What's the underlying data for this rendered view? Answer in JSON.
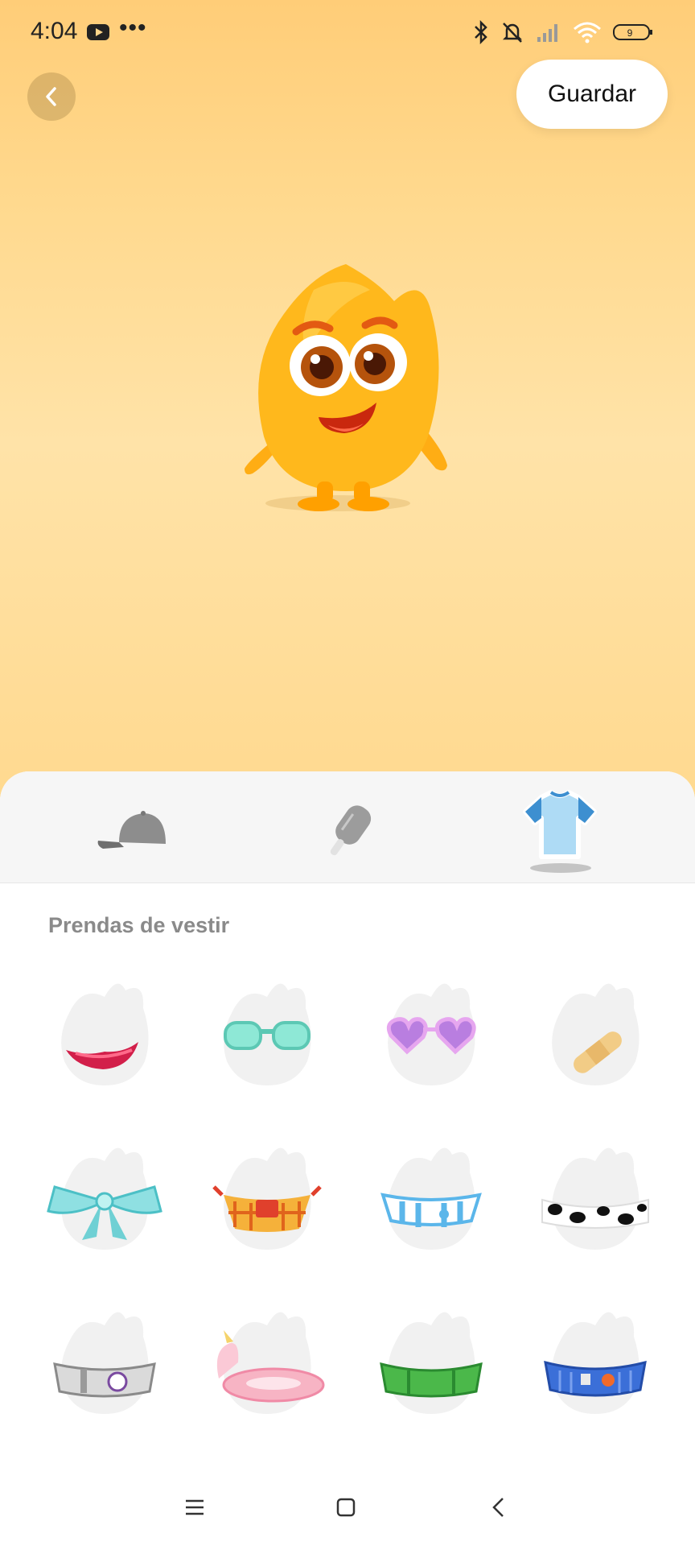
{
  "status_bar": {
    "time": "4:04",
    "battery": "9",
    "icons": [
      "youtube-icon",
      "more-dots-icon",
      "bluetooth-icon",
      "bell-off-icon",
      "signal-icon",
      "wifi-icon",
      "battery-icon"
    ]
  },
  "header": {
    "save_label": "Guardar",
    "back_icon": "chevron-left-icon"
  },
  "tabs": [
    {
      "name": "cap-icon",
      "selected": false
    },
    {
      "name": "popsicle-icon",
      "selected": false
    },
    {
      "name": "tshirt-icon",
      "selected": true
    }
  ],
  "section": {
    "title": "Prendas de vestir"
  },
  "items": [
    {
      "icon": "red-lips-icon"
    },
    {
      "icon": "teal-sunglasses-icon"
    },
    {
      "icon": "heart-glasses-icon"
    },
    {
      "icon": "bandage-icon"
    },
    {
      "icon": "teal-bow-icon"
    },
    {
      "icon": "plaid-apron-icon"
    },
    {
      "icon": "striped-top-icon"
    },
    {
      "icon": "cow-print-band-icon"
    },
    {
      "icon": "silver-belt-icon"
    },
    {
      "icon": "unicorn-float-icon"
    },
    {
      "icon": "green-belt-icon"
    },
    {
      "icon": "blue-belt-icon"
    }
  ],
  "colors": {
    "hero_top": "#ffcd78",
    "hero_bottom": "#ffe3a8",
    "mascot": "#ffb300"
  }
}
